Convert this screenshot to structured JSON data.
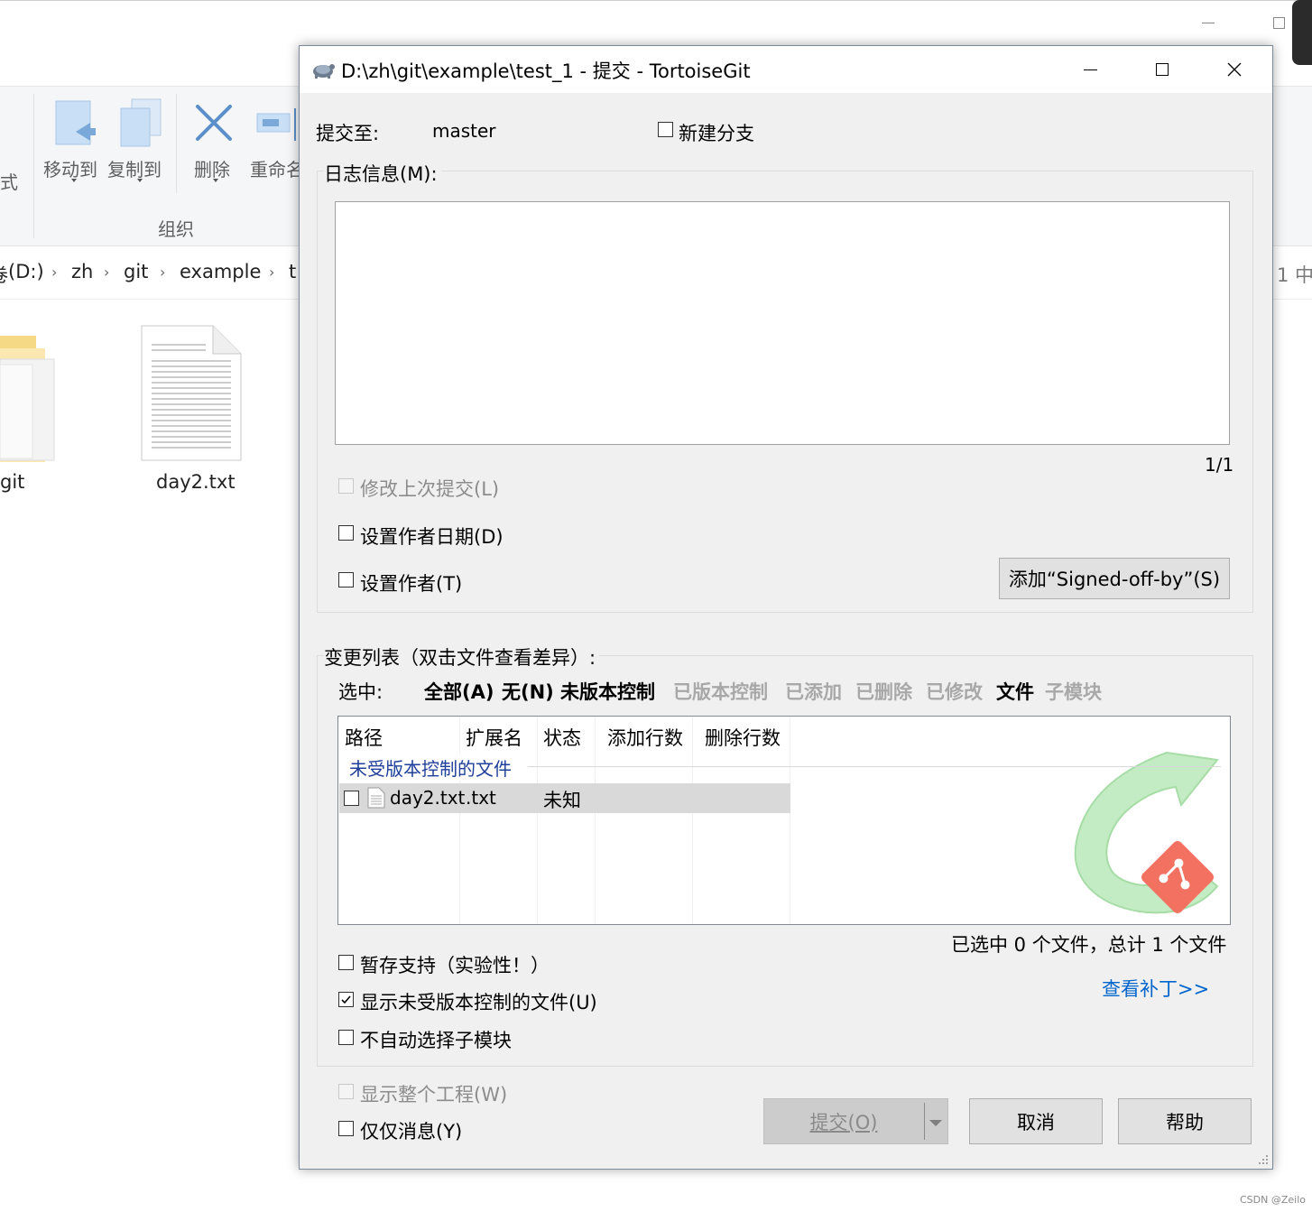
{
  "explorer": {
    "ribbon_left_partial": "式",
    "ribbon_buttons": [
      {
        "label": "移动到"
      },
      {
        "label": "复制到"
      },
      {
        "label": "删除"
      },
      {
        "label": "重命名"
      }
    ],
    "ribbon_group": "组织",
    "breadcrumb": [
      "(D:)",
      "zh",
      "git",
      "example",
      "t"
    ],
    "breadcrumb_prefix": "卷",
    "search_partial": "1 中",
    "files": [
      {
        "name": "git"
      },
      {
        "name": "day2.txt"
      }
    ]
  },
  "dialog": {
    "title": "D:\\zh\\git\\example\\test_1 - 提交 - TortoiseGit",
    "commit_to_label": "提交至:",
    "branch": "master",
    "new_branch_label": "新建分支",
    "log_label": "日志信息(M):",
    "message_value": "",
    "line_counter": "1/1",
    "amend_label": "修改上次提交(L)",
    "set_author_date_label": "设置作者日期(D)",
    "set_author_label": "设置作者(T)",
    "signed_off_button": "添加“Signed-off-by”(S)",
    "changes_label": "变更列表（双击文件查看差异）:",
    "select_label": "选中:",
    "select_filters": [
      {
        "label": "全部(A)",
        "enabled": true
      },
      {
        "label": "无(N)",
        "enabled": true
      },
      {
        "label": "未版本控制",
        "enabled": true
      },
      {
        "label": "已版本控制",
        "enabled": false
      },
      {
        "label": "已添加",
        "enabled": false
      },
      {
        "label": "已删除",
        "enabled": false
      },
      {
        "label": "已修改",
        "enabled": false
      },
      {
        "label": "文件",
        "enabled": true
      },
      {
        "label": "子模块",
        "enabled": false
      }
    ],
    "columns": [
      "路径",
      "扩展名",
      "状态",
      "添加行数",
      "删除行数"
    ],
    "group_header": "未受版本控制的文件",
    "rows": [
      {
        "path": "day2.txt",
        "ext": ".txt",
        "status": "未知",
        "added": "",
        "deleted": "",
        "checked": false
      }
    ],
    "summary": "已选中 0 个文件，总计 1 个文件",
    "stash_label": "暂存支持（实验性！）",
    "show_unversioned_label": "显示未受版本控制的文件(U)",
    "show_unversioned_checked": true,
    "no_auto_submodule_label": "不自动选择子模块",
    "view_patch_link": "查看补丁>>",
    "show_whole_project_label": "显示整个工程(W)",
    "message_only_label": "仅仅消息(Y)",
    "commit_button": "提交(O)",
    "cancel_button": "取消",
    "help_button": "帮助",
    "accent_link_color": "#0066cc",
    "group_header_color": "#1e3f9a"
  },
  "watermark": "CSDN @Zeilo"
}
